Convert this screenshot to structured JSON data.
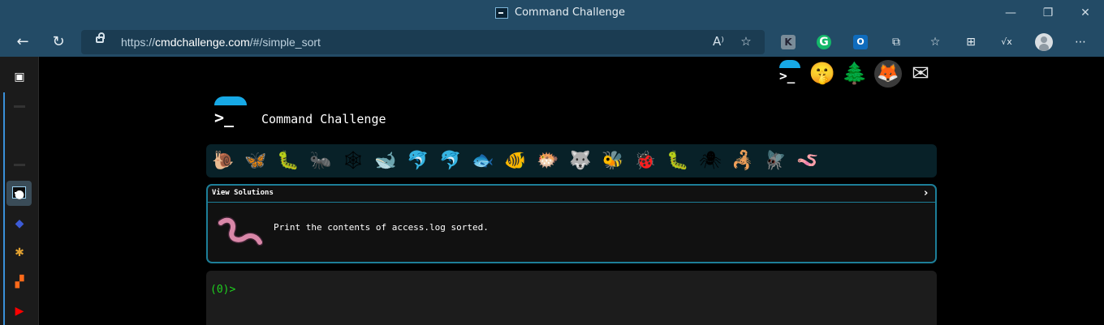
{
  "window": {
    "title": "Command Challenge",
    "minimize": "—",
    "restore": "❐",
    "close": "✕"
  },
  "nav": {
    "back_icon": "←",
    "refresh_icon": "↻",
    "url_scheme": "https://",
    "url_host": "cmdchallenge.com",
    "url_path": "/#/simple_sort",
    "read_aloud_icon": "A⁾",
    "favorite_icon": "☆",
    "ext_k": "K",
    "ext_g": "G",
    "ext_o": "O",
    "extensions_icon": "⧉",
    "favorites_icon": "☆",
    "collections_icon": "⊞",
    "math_icon": "√x",
    "menu_icon": "⋯"
  },
  "sidebar": {
    "panel_icon": "▣",
    "icons": [
      {
        "name": "github-icon",
        "glyph": "●",
        "color": "#ffffff"
      },
      {
        "name": "linear-icon",
        "glyph": "◆",
        "color": "#3c5bd6"
      },
      {
        "name": "slack-icon",
        "glyph": "✱",
        "color": "#e0a030"
      },
      {
        "name": "zapier-icon",
        "glyph": "▞",
        "color": "#ff6a1a"
      },
      {
        "name": "youtube-icon",
        "glyph": "▶",
        "color": "#ff0000"
      }
    ]
  },
  "header_icons": {
    "terminal_prompt": ">_",
    "emoji": "🤫",
    "tree": "🌲",
    "gitlab": "🦊",
    "mail": "✉"
  },
  "site": {
    "logo_prompt": ">_",
    "title": "Command Challenge"
  },
  "animals": [
    "🐌",
    "🦋",
    "🐛",
    "🐜",
    "🕸",
    "🐋",
    "🐬",
    "🐬",
    "🐟",
    "🐠",
    "🐡",
    "🐺",
    "🐝",
    "🐞",
    "🐛",
    "🕷",
    "🦂",
    "🪰",
    "🪱"
  ],
  "panel": {
    "title": "View Solutions",
    "chevron": "›",
    "task": "Print the contents of access.log sorted."
  },
  "terminal": {
    "prompt": "(0)>"
  },
  "colors": {
    "accent": "#17a9e6",
    "panel_border": "#1d7e98",
    "prompt_green": "#1fd11f",
    "chrome": "#234b66"
  }
}
